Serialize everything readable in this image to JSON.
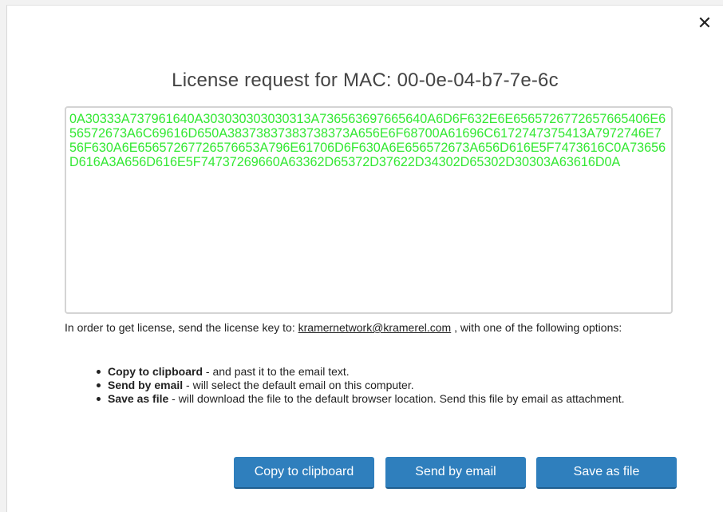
{
  "dialog": {
    "close_glyph": "✕",
    "title": "License request for MAC: 00-0e-04-b7-7e-6c",
    "license_key": "0A30333A737961640A303030303030313A736563697665640A6D6F632E6E6565726772657665406E656572673A6C69616D650A38373837383738373A656E6F68700A61696C6172747375413A7972746E756F630A6E65657267726576653A796E61706D6F630A6E656572673A656D616E5F7473616C0A73656D616A3A656D616E5F74737269660A63362D65372D37622D34302D65302D30303A63616D0A",
    "instructions_prefix": "In order to get license, send the license key to: ",
    "email": "kramernetwork@kramerel.com",
    "instructions_suffix": " , with one of the following options:",
    "options": [
      {
        "label": "Copy to clipboard",
        "text": " - and past it to the email text."
      },
      {
        "label": "Send by email",
        "text": " - will select the default email on this computer."
      },
      {
        "label": "Save as file",
        "text": " - will download the file to the default browser location. Send this file by email as attachment."
      }
    ],
    "buttons": {
      "copy": "Copy to clipboard",
      "email": "Send by email",
      "save": "Save as file"
    },
    "colors": {
      "key_text": "#33e833",
      "button_bg": "#2f7fbd"
    }
  }
}
